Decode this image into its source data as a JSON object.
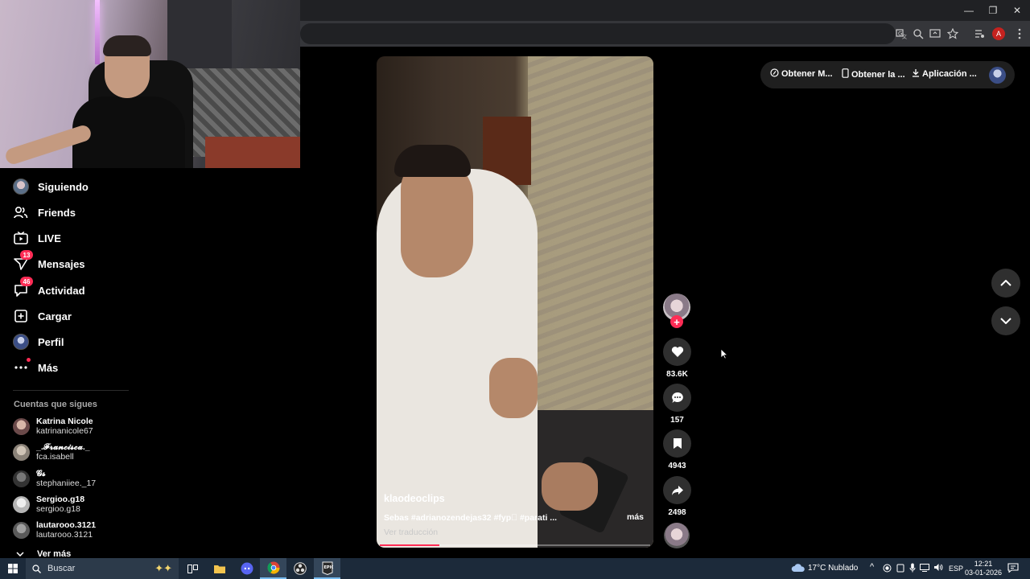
{
  "browser": {
    "window_controls": [
      "—",
      "❐",
      "✕"
    ],
    "profile_initial": "A"
  },
  "sidebar": {
    "nav": [
      {
        "label": "Siguiendo",
        "icon": "avatar-icon"
      },
      {
        "label": "Friends",
        "icon": "friends-icon"
      },
      {
        "label": "LIVE",
        "icon": "live-icon"
      },
      {
        "label": "Mensajes",
        "icon": "messages-icon",
        "badge": "13"
      },
      {
        "label": "Actividad",
        "icon": "activity-icon",
        "badge": "46"
      },
      {
        "label": "Cargar",
        "icon": "upload-icon"
      },
      {
        "label": "Perfil",
        "icon": "profile-avatar-icon"
      },
      {
        "label": "Más",
        "icon": "more-icon"
      }
    ],
    "following_title": "Cuentas que sigues",
    "following": [
      {
        "name": "Katrina Nicole",
        "user": "katrinanicole67",
        "color": "#6b4a4a"
      },
      {
        "name": "_.𝓕𝓻𝓪𝓷𝓬𝓲𝓼𝓬𝓪._",
        "user": "fca.isabell",
        "color": "#8a8278"
      },
      {
        "name": "𝓖𝓼",
        "user": "stephaniiee._17",
        "color": "#333333"
      },
      {
        "name": "Sergioo.g18",
        "user": "sergioo.g18",
        "color": "#b5b5b5"
      },
      {
        "name": "lautarooo.3121",
        "user": "lautarooo.3121",
        "color": "#5a5a5a"
      }
    ],
    "see_more": "Ver más"
  },
  "video": {
    "username": "klaodeoclips",
    "caption": "Sebas #adrianozendejas32 #fyp゚ #parati ...",
    "more": "más",
    "translate": "Ver traducción",
    "progress": 0.22
  },
  "actions": {
    "like_count": "83.6K",
    "comment_count": "157",
    "save_count": "4943",
    "share_count": "2498"
  },
  "top_bar": {
    "items": [
      "Obtener M...",
      "Obtener la ...",
      "Aplicación ..."
    ]
  },
  "taskbar": {
    "search_placeholder": "Buscar",
    "weather": "17°C  Nublado",
    "lang": "ESP",
    "time": "12:21",
    "date": "03-01-2026"
  },
  "colors": {
    "accent": "#fe2c55",
    "taskbar": "#1c2a3a"
  }
}
